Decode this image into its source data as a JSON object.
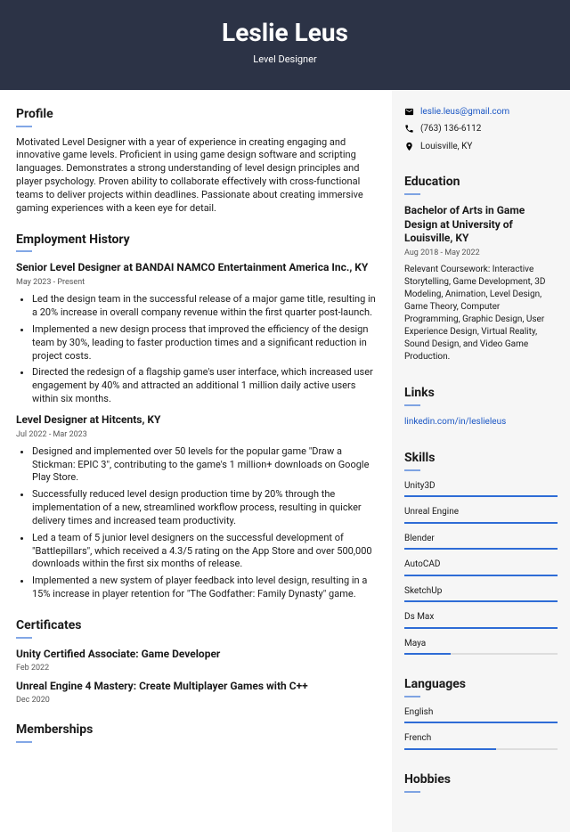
{
  "header": {
    "name": "Leslie Leus",
    "title": "Level Designer"
  },
  "profile": {
    "heading": "Profile",
    "text": "Motivated Level Designer with a year of experience in creating engaging and innovative game levels. Proficient in using game design software and scripting languages. Demonstrates a strong understanding of level design principles and player psychology. Proven ability to collaborate effectively with cross-functional teams to deliver projects within deadlines. Passionate about creating immersive gaming experiences with a keen eye for detail."
  },
  "employment": {
    "heading": "Employment History",
    "jobs": [
      {
        "title": "Senior Level Designer at BANDAI NAMCO Entertainment America Inc., KY",
        "date": "May 2023 - Present",
        "bullets": [
          "Led the design team in the successful release of a major game title, resulting in a 20% increase in overall company revenue within the first quarter post-launch.",
          "Implemented a new design process that improved the efficiency of the design team by 30%, leading to faster production times and a significant reduction in project costs.",
          "Directed the redesign of a flagship game's user interface, which increased user engagement by 40% and attracted an additional 1 million daily active users within six months."
        ]
      },
      {
        "title": "Level Designer at Hitcents, KY",
        "date": "Jul 2022 - Mar 2023",
        "bullets": [
          "Designed and implemented over 50 levels for the popular game \"Draw a Stickman: EPIC 3\", contributing to the game's 1 million+ downloads on Google Play Store.",
          "Successfully reduced level design production time by 20% through the implementation of a new, streamlined workflow process, resulting in quicker delivery times and increased team productivity.",
          "Led a team of 5 junior level designers on the successful development of \"Battlepillars\", which received a 4.3/5 rating on the App Store and over 500,000 downloads within the first six months of release.",
          "Implemented a new system of player feedback into level design, resulting in a 15% increase in player retention for \"The Godfather: Family Dynasty\" game."
        ]
      }
    ]
  },
  "certificates": {
    "heading": "Certificates",
    "items": [
      {
        "title": "Unity Certified Associate: Game Developer",
        "date": "Feb 2022"
      },
      {
        "title": "Unreal Engine 4 Mastery: Create Multiplayer Games with C++",
        "date": "Dec 2020"
      }
    ]
  },
  "memberships": {
    "heading": "Memberships"
  },
  "contact": {
    "email": "leslie.leus@gmail.com",
    "phone": "(763) 136-6112",
    "location": "Louisville, KY"
  },
  "education": {
    "heading": "Education",
    "title": "Bachelor of Arts in Game Design at University of Louisville, KY",
    "date": "Aug 2018 - May 2022",
    "desc": "Relevant Coursework: Interactive Storytelling, Game Development, 3D Modeling, Animation, Level Design, Game Theory, Computer Programming, Graphic Design, User Experience Design, Virtual Reality, Sound Design, and Video Game Production."
  },
  "links": {
    "heading": "Links",
    "url": "linkedin.com/in/leslieleus"
  },
  "skills": {
    "heading": "Skills",
    "items": [
      {
        "name": "Unity3D",
        "level": 100
      },
      {
        "name": "Unreal Engine",
        "level": 100
      },
      {
        "name": "Blender",
        "level": 100
      },
      {
        "name": "AutoCAD",
        "level": 100
      },
      {
        "name": "SketchUp",
        "level": 100
      },
      {
        "name": "Ds Max",
        "level": 100
      },
      {
        "name": "Maya",
        "level": 30
      }
    ]
  },
  "languages": {
    "heading": "Languages",
    "items": [
      {
        "name": "English",
        "level": 100
      },
      {
        "name": "French",
        "level": 60
      }
    ]
  },
  "hobbies": {
    "heading": "Hobbies"
  }
}
